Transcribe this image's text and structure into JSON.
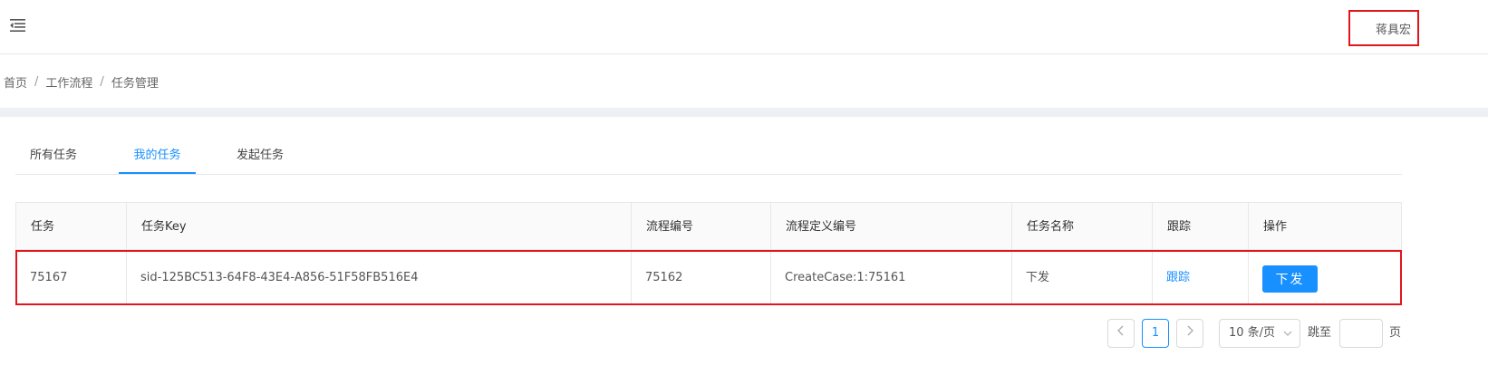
{
  "header": {
    "menu_icon": "menu-fold-icon",
    "user_name": "蒋具宏"
  },
  "breadcrumb": {
    "items": [
      "首页",
      "工作流程",
      "任务管理"
    ],
    "separator": "/"
  },
  "tabs": [
    {
      "label": "所有任务",
      "active": false
    },
    {
      "label": "我的任务",
      "active": true
    },
    {
      "label": "发起任务",
      "active": false
    }
  ],
  "table": {
    "columns": [
      "任务",
      "任务Key",
      "流程编号",
      "流程定义编号",
      "任务名称",
      "跟踪",
      "操作"
    ],
    "rows": [
      {
        "task": "75167",
        "task_key": "sid-125BC513-64F8-43E4-A856-51F58FB516E4",
        "process_id": "75162",
        "process_def_id": "CreateCase:1:75161",
        "task_name": "下发",
        "track": "跟踪",
        "action": "下发"
      }
    ]
  },
  "pagination": {
    "prev_icon": "chevron-left-icon",
    "next_icon": "chevron-right-icon",
    "current_page": "1",
    "page_size": "10 条/页",
    "jump_label": "跳至",
    "page_suffix": "页",
    "jump_value": ""
  },
  "colors": {
    "accent": "#1890ff",
    "highlight": "#e0161c",
    "band": "#edf0f4"
  }
}
